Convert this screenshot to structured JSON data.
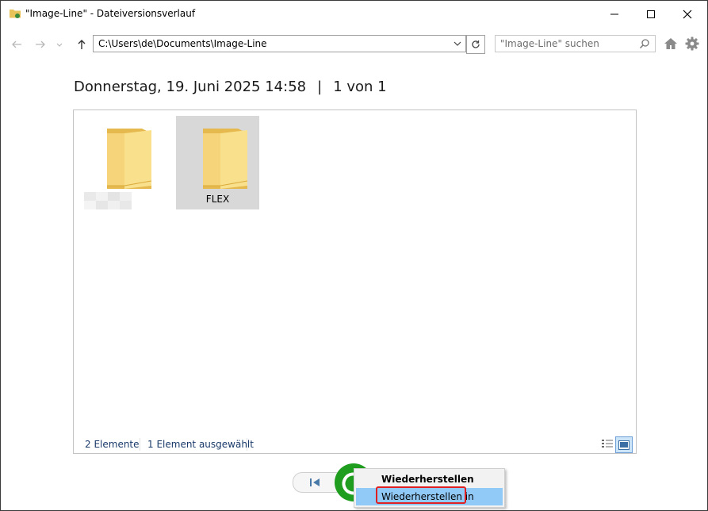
{
  "window": {
    "title": "\"Image-Line\" - Dateiversionsverlauf"
  },
  "navbar": {
    "address": "C:\\Users\\de\\Documents\\Image-Line",
    "search_placeholder": "\"Image-Line\" suchen"
  },
  "header": {
    "date": "Donnerstag, 19. Juni 2025 14:58",
    "separator": "|",
    "page": "1 von 1"
  },
  "files": [
    {
      "label": "",
      "selected": false
    },
    {
      "label": "FLEX",
      "selected": true
    }
  ],
  "status": {
    "count": "2 Elemente",
    "selection": "1 Element ausgewählt"
  },
  "context_menu": {
    "items": [
      {
        "label": "Wiederherstellen"
      },
      {
        "label": "Wiederherstellen in"
      }
    ]
  },
  "colors": {
    "folder": "#f6d57a",
    "restore_button": "#1f9d1f",
    "highlight": "#91c9f7",
    "outline": "#e02020"
  }
}
